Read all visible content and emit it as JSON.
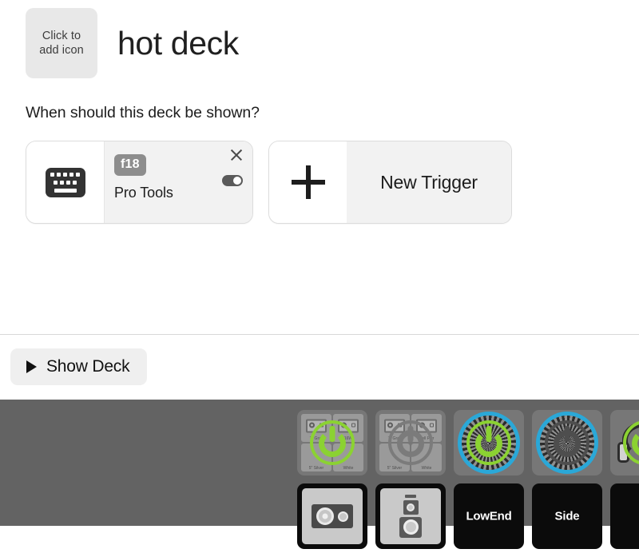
{
  "header": {
    "icon_placeholder_line1": "Click to",
    "icon_placeholder_line2": "add icon",
    "title": "hot deck"
  },
  "prompt": "When should this deck be shown?",
  "triggers": [
    {
      "icon": "keyboard-icon",
      "key_badge": "f18",
      "app_name": "Pro Tools",
      "close_icon": "close-icon",
      "toggle_state": "on"
    }
  ],
  "new_trigger": {
    "plus_icon": "plus-icon",
    "label": "New Trigger"
  },
  "footer": {
    "show_deck_label": "Show Deck",
    "play_icon": "play-triangle-icon"
  },
  "deck_panel": {
    "background_color": "#636363",
    "rows": [
      {
        "tiles": [
          {
            "kind": "quad-power-green",
            "label": "",
            "cells": [
              "7\" Gray",
              "16W",
              "5\" Silver",
              "White"
            ]
          },
          {
            "kind": "quad-power-gray",
            "label": "",
            "cells": [
              "7\" Gray",
              "Dell Pwr",
              "5\" Silver",
              "White"
            ]
          },
          {
            "kind": "ring-power-green",
            "label": ""
          },
          {
            "kind": "ring-power-dark",
            "label": ""
          },
          {
            "kind": "headphones-power-green",
            "label": ""
          }
        ]
      },
      {
        "tiles": [
          {
            "kind": "speaker-wide",
            "label": ""
          },
          {
            "kind": "speaker-tall",
            "label": ""
          },
          {
            "kind": "text-dark",
            "label": "LowEnd"
          },
          {
            "kind": "text-dark",
            "label": "Side"
          },
          {
            "kind": "empty-dark",
            "label": ""
          }
        ]
      }
    ]
  },
  "colors": {
    "accent_green": "#8bd232",
    "accent_blue": "#2aa8d8",
    "panel_gray": "#636363",
    "card_body_gray": "#f2f2f2",
    "badge_gray": "#8d8d8d"
  }
}
